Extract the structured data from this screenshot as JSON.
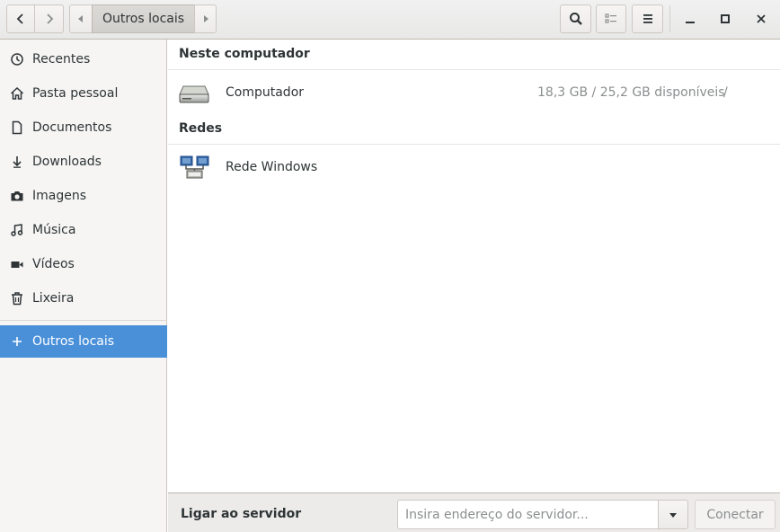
{
  "header": {
    "path_label": "Outros locais",
    "icons": [
      "go-back-icon",
      "go-forward-icon",
      "path-left-icon",
      "path-right-icon",
      "search-icon",
      "view-list-icon",
      "menu-icon",
      "minimize-icon",
      "maximize-icon",
      "close-icon"
    ]
  },
  "sidebar": {
    "items": [
      {
        "label": "Recentes",
        "icon": "clock-icon"
      },
      {
        "label": "Pasta pessoal",
        "icon": "home-icon"
      },
      {
        "label": "Documentos",
        "icon": "document-icon"
      },
      {
        "label": "Downloads",
        "icon": "download-icon"
      },
      {
        "label": "Imagens",
        "icon": "camera-icon"
      },
      {
        "label": "Música",
        "icon": "music-icon"
      },
      {
        "label": "Vídeos",
        "icon": "video-icon"
      },
      {
        "label": "Lixeira",
        "icon": "trash-icon"
      }
    ],
    "other_locations": {
      "label": "Outros locais",
      "icon": "plus-icon"
    },
    "selected_color": "#4a90d9"
  },
  "main": {
    "section_computer": "Neste computador",
    "computer": {
      "label": "Computador",
      "info": "18,3 GB / 25,2 GB disponíveis",
      "path": "/",
      "icon": "drive-harddisk-icon"
    },
    "section_networks": "Redes",
    "network": {
      "label": "Rede Windows",
      "icon": "network-workgroup-icon"
    }
  },
  "bottom": {
    "label": "Ligar ao servidor",
    "input_placeholder": "Insira endereço do servidor...",
    "input_value": "",
    "connect_label": "Conectar"
  }
}
